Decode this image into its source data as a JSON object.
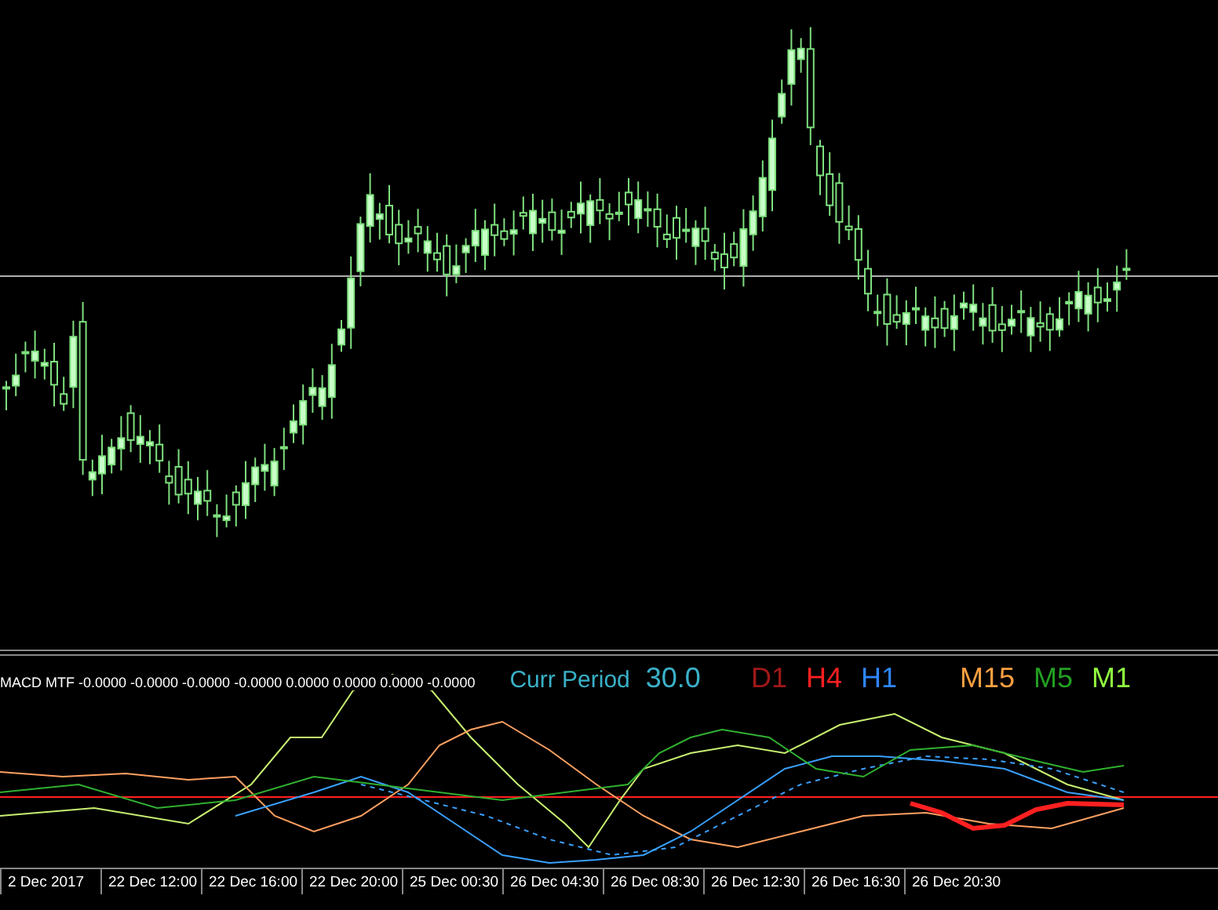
{
  "indicator": {
    "header": "MACD MTF -0.0000 -0.0000 -0.0000 -0.0000 0.0000 0.0000 0.0000 -0.0000",
    "current_period": {
      "label": "Curr Period",
      "value": "30.0"
    },
    "legend": [
      {
        "label": "D1",
        "color": "#a01818"
      },
      {
        "label": "H4",
        "color": "#ff2020"
      },
      {
        "label": "H1",
        "color": "#2e86ff"
      },
      {
        "label": "M15",
        "color": "#ffa040"
      },
      {
        "label": "M5",
        "color": "#22a022"
      },
      {
        "label": "M1",
        "color": "#90ff40"
      }
    ]
  },
  "time_axis": [
    "2 Dec 2017",
    "22 Dec 12:00",
    "22 Dec 16:00",
    "22 Dec 20:00",
    "25 Dec 00:30",
    "26 Dec 04:30",
    "26 Dec 08:30",
    "26 Dec 12:30",
    "26 Dec 16:30",
    "26 Dec 20:30"
  ]
}
